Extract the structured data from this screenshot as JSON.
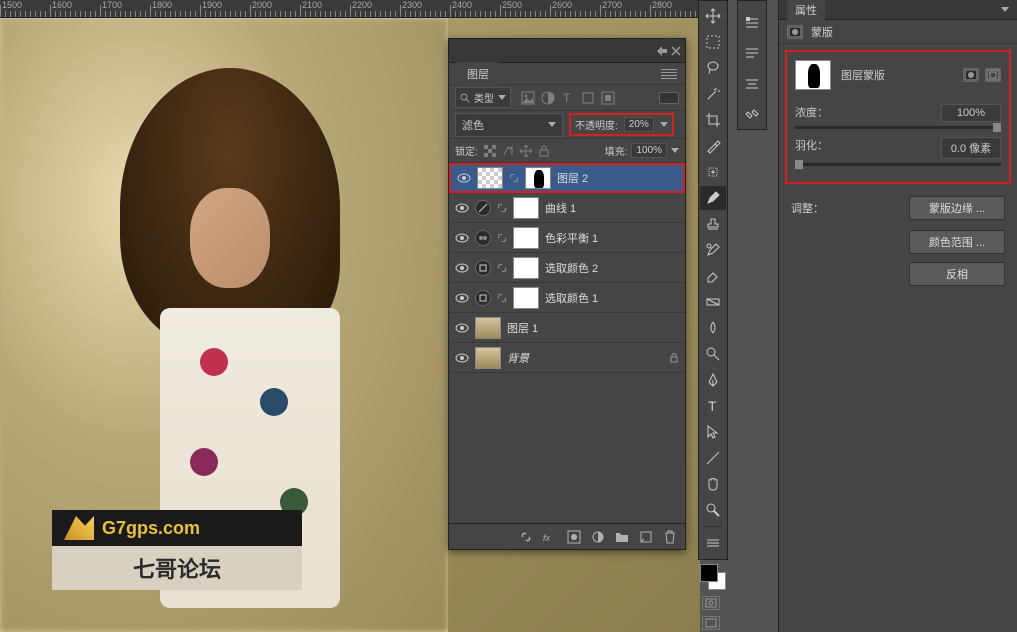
{
  "ruler": {
    "marks": [
      1500,
      1600,
      1700,
      1800,
      1900,
      2000,
      2100,
      2200,
      2300,
      2400,
      2500,
      2600,
      2700,
      2800
    ]
  },
  "watermark": {
    "url": "G7gps.com",
    "text": "七哥论坛"
  },
  "layers_panel": {
    "title": "图层",
    "filter_label": "类型",
    "blend_mode": "滤色",
    "opacity_label": "不透明度:",
    "opacity_value": "20%",
    "lock_label": "锁定:",
    "fill_label": "填充:",
    "fill_value": "100%",
    "layers": [
      {
        "name": "图层 2",
        "selected": true,
        "type": "pixel_masked"
      },
      {
        "name": "曲线 1",
        "type": "adjustment"
      },
      {
        "name": "色彩平衡 1",
        "type": "adjustment"
      },
      {
        "name": "选取颜色 2",
        "type": "adjustment"
      },
      {
        "name": "选取颜色 1",
        "type": "adjustment"
      },
      {
        "name": "图层 1",
        "type": "image"
      },
      {
        "name": "背景",
        "type": "background",
        "locked": true
      }
    ]
  },
  "properties_panel": {
    "tab": "属性",
    "header": "蒙版",
    "mask_label": "图层蒙版",
    "density_label": "浓度：",
    "density_value": "100%",
    "feather_label": "羽化：",
    "feather_value": "0.0 像素",
    "adjust_label": "调整：",
    "buttons": {
      "mask_edge": "蒙版边缘 ...",
      "color_range": "颜色范围 ...",
      "invert": "反相"
    }
  }
}
